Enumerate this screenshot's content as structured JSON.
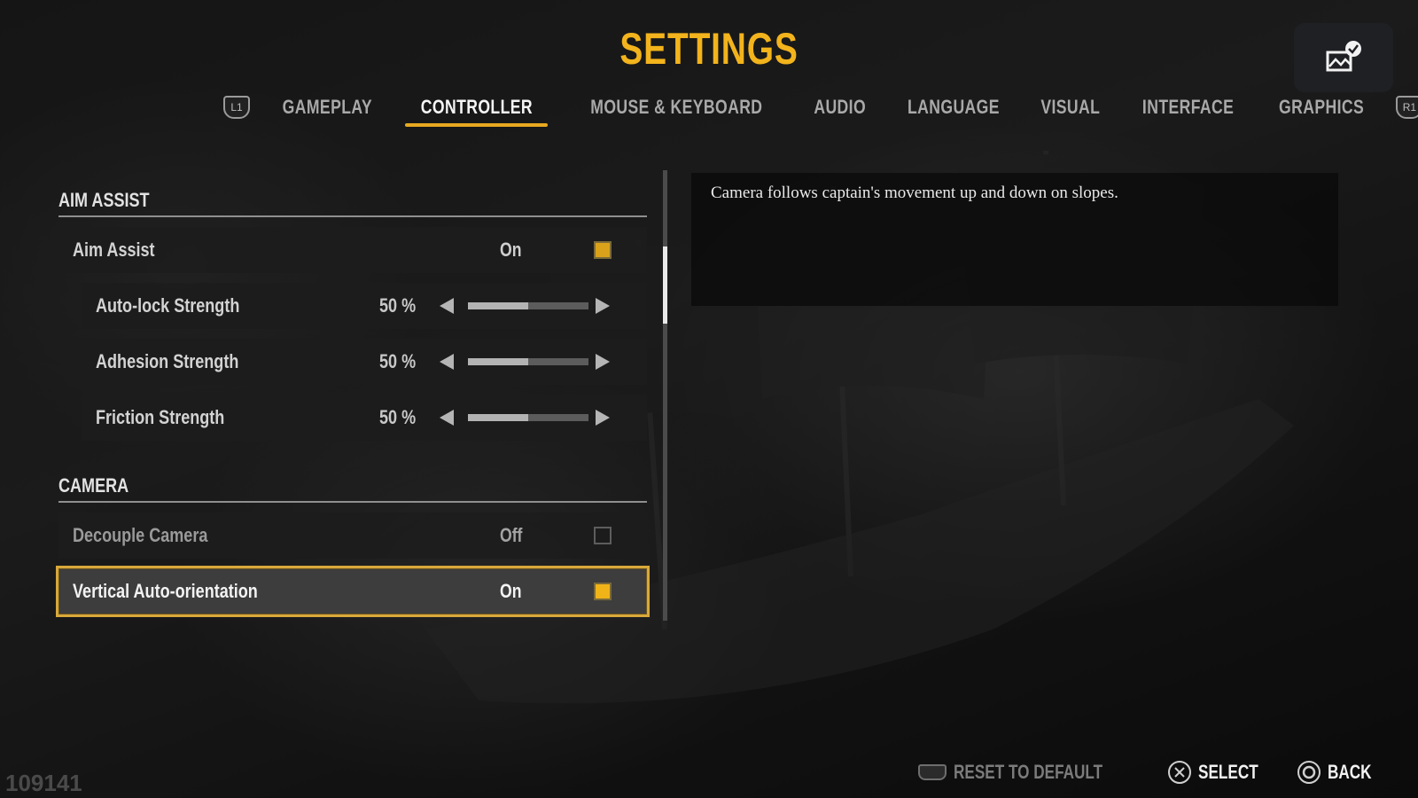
{
  "title": "SETTINGS",
  "tabs": {
    "left_bumper": "L1",
    "right_bumper": "R1",
    "items": [
      {
        "label": "GAMEPLAY",
        "active": false
      },
      {
        "label": "CONTROLLER",
        "active": true
      },
      {
        "label": "MOUSE & KEYBOARD",
        "active": false
      },
      {
        "label": "AUDIO",
        "active": false
      },
      {
        "label": "LANGUAGE",
        "active": false
      },
      {
        "label": "VISUAL",
        "active": false
      },
      {
        "label": "INTERFACE",
        "active": false
      },
      {
        "label": "GRAPHICS",
        "active": false
      }
    ]
  },
  "top_right_icon": "performance-check-icon",
  "sections": {
    "aim_assist": {
      "title": "AIM ASSIST",
      "toggle": {
        "label": "Aim Assist",
        "value": "On",
        "checked": true
      },
      "sliders": [
        {
          "label": "Auto-lock Strength",
          "value_text": "50 %",
          "value": 50
        },
        {
          "label": "Adhesion Strength",
          "value_text": "50 %",
          "value": 50
        },
        {
          "label": "Friction Strength",
          "value_text": "50 %",
          "value": 50
        }
      ]
    },
    "camera": {
      "title": "CAMERA",
      "toggles": [
        {
          "label": "Decouple Camera",
          "value": "Off",
          "checked": false,
          "selected": false
        },
        {
          "label": "Vertical Auto-orientation",
          "value": "On",
          "checked": true,
          "selected": true
        }
      ]
    }
  },
  "scrollbar": {
    "thumb_start": 0.17,
    "thumb_size": 0.17
  },
  "description": "Camera follows captain's movement up and down on slopes.",
  "footer": {
    "reset": "RESET TO DEFAULT",
    "select": "SELECT",
    "back": "BACK"
  },
  "watermark": "109141",
  "colors": {
    "accent": "#f2b31c",
    "checkbox_on": "#d9a21a"
  }
}
